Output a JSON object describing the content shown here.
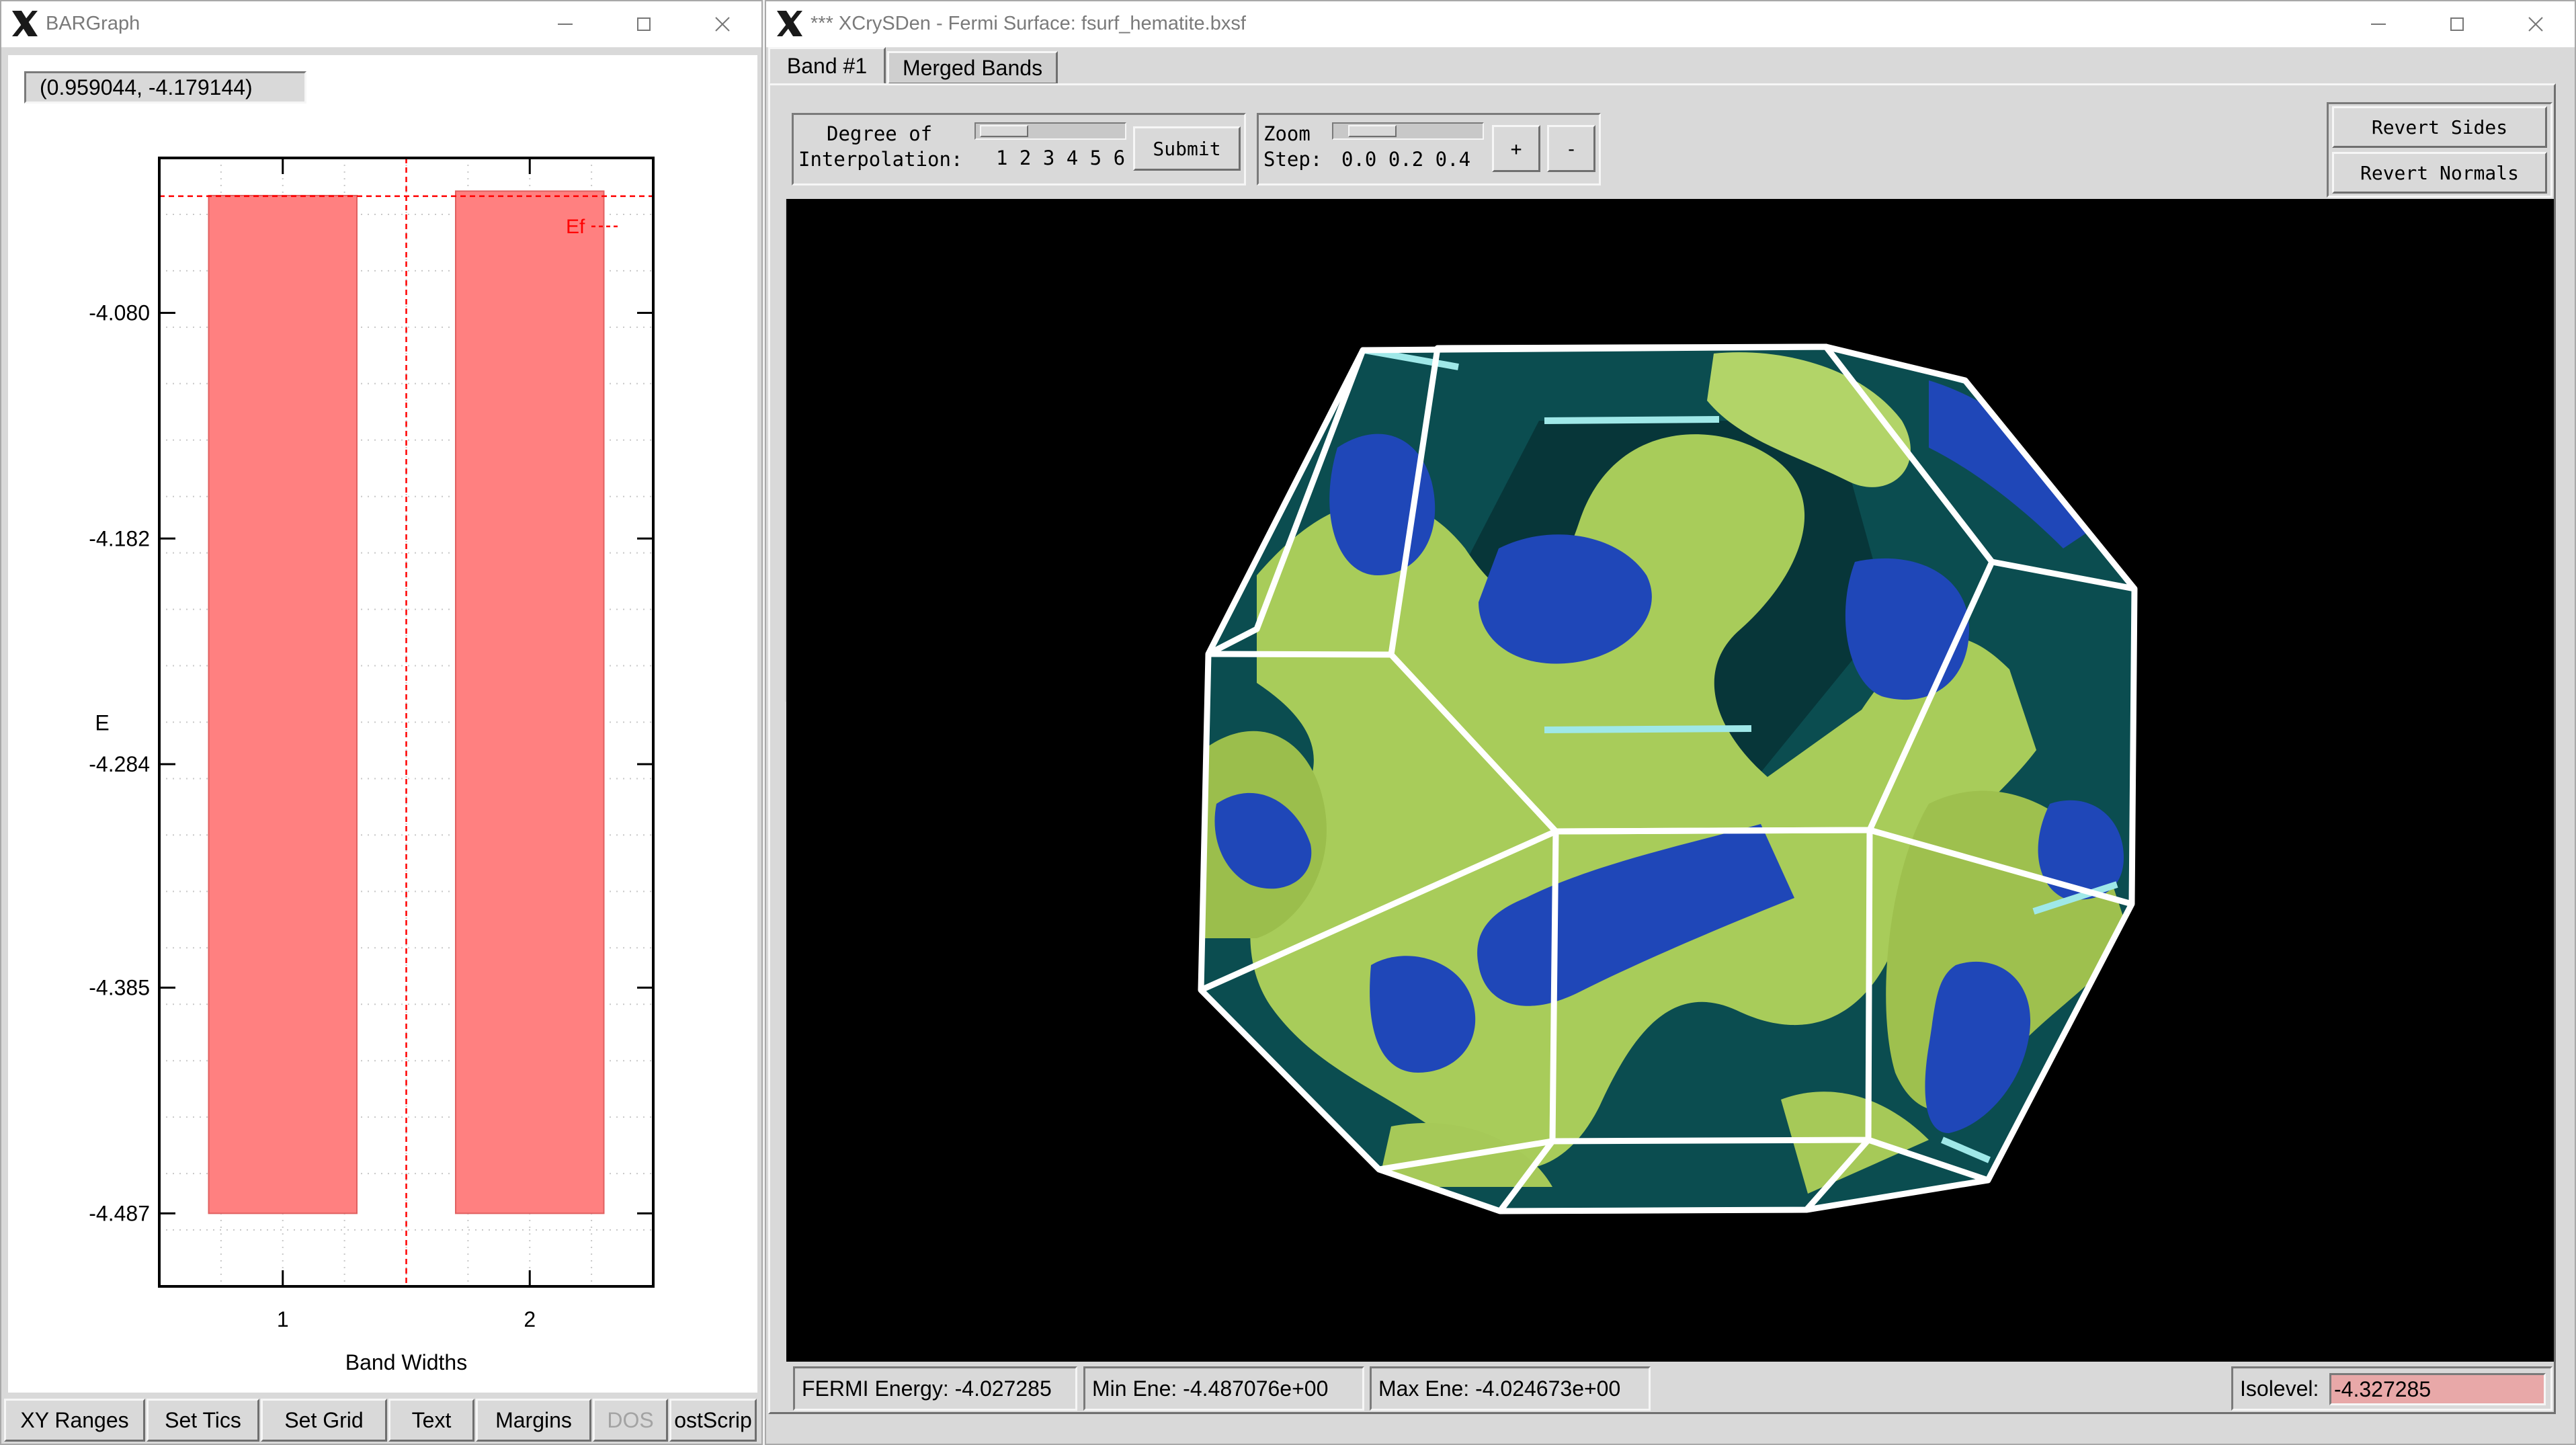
{
  "bargraph": {
    "window_title": "BARGraph",
    "coord_readout": "(0.959044, -4.179144)",
    "fermi_label": "Ef",
    "menu_buttons": [
      "XY Ranges",
      "Set Tics",
      "Set Grid",
      "Text",
      "Margins",
      "DOS",
      "ostScrip"
    ],
    "disabled_button_index": 5
  },
  "chart_data": {
    "type": "bar",
    "categories": [
      "1",
      "2"
    ],
    "series": [
      {
        "values": [
          [
            -4.487,
            -4.027
          ],
          [
            -4.487,
            -4.025
          ]
        ]
      }
    ],
    "value_format": "each bar spans [min, max] energy",
    "fermi_energy": -4.027285,
    "xlabel": "Band Widths",
    "ylabel": "E",
    "yticks": [
      "-4.080",
      "-4.182",
      "-4.284",
      "-4.385",
      "-4.487"
    ],
    "ylim": [
      -4.52,
      -4.01
    ],
    "grid": true,
    "bar_color": "#ff8080"
  },
  "xcrysden": {
    "window_title": "*** XCrySDen - Fermi Surface: fsurf_hematite.bxsf",
    "tabs": [
      "Band #1",
      "Merged Bands"
    ],
    "active_tab": "Band #1",
    "interp_label_1": "Degree of",
    "interp_label_2": "Interpolation:",
    "interp_scale": "1 2 3 4 5 6",
    "submit_label": "Submit",
    "zoom_label_1": "Zoom",
    "zoom_label_2": "Step:",
    "zoom_scale": "0.0 0.2 0.4",
    "zoom_in_label": "+",
    "zoom_out_label": "-",
    "revert_sides_label": "Revert Sides",
    "revert_normals_label": "Revert Normals",
    "toolbox_icons": [
      "cell-render-icon",
      "cell-edges-icon",
      "wire-cell-icon",
      "points-icon",
      "wireframe-icon",
      "sphere-icon",
      "solid-cell-icon"
    ],
    "status": {
      "fermi": "FERMI Energy: -4.027285",
      "min": "Min Ene: -4.487076e+00",
      "max": "Max Ene: -4.024673e+00",
      "isolevel_label": "Isolevel:",
      "isolevel_value": "-4.327285"
    },
    "colors": {
      "surface_green": "#a8cc5a",
      "surface_blue": "#1f47b8",
      "zone_teal": "#0b4d50",
      "edge": "#ffffff"
    }
  }
}
